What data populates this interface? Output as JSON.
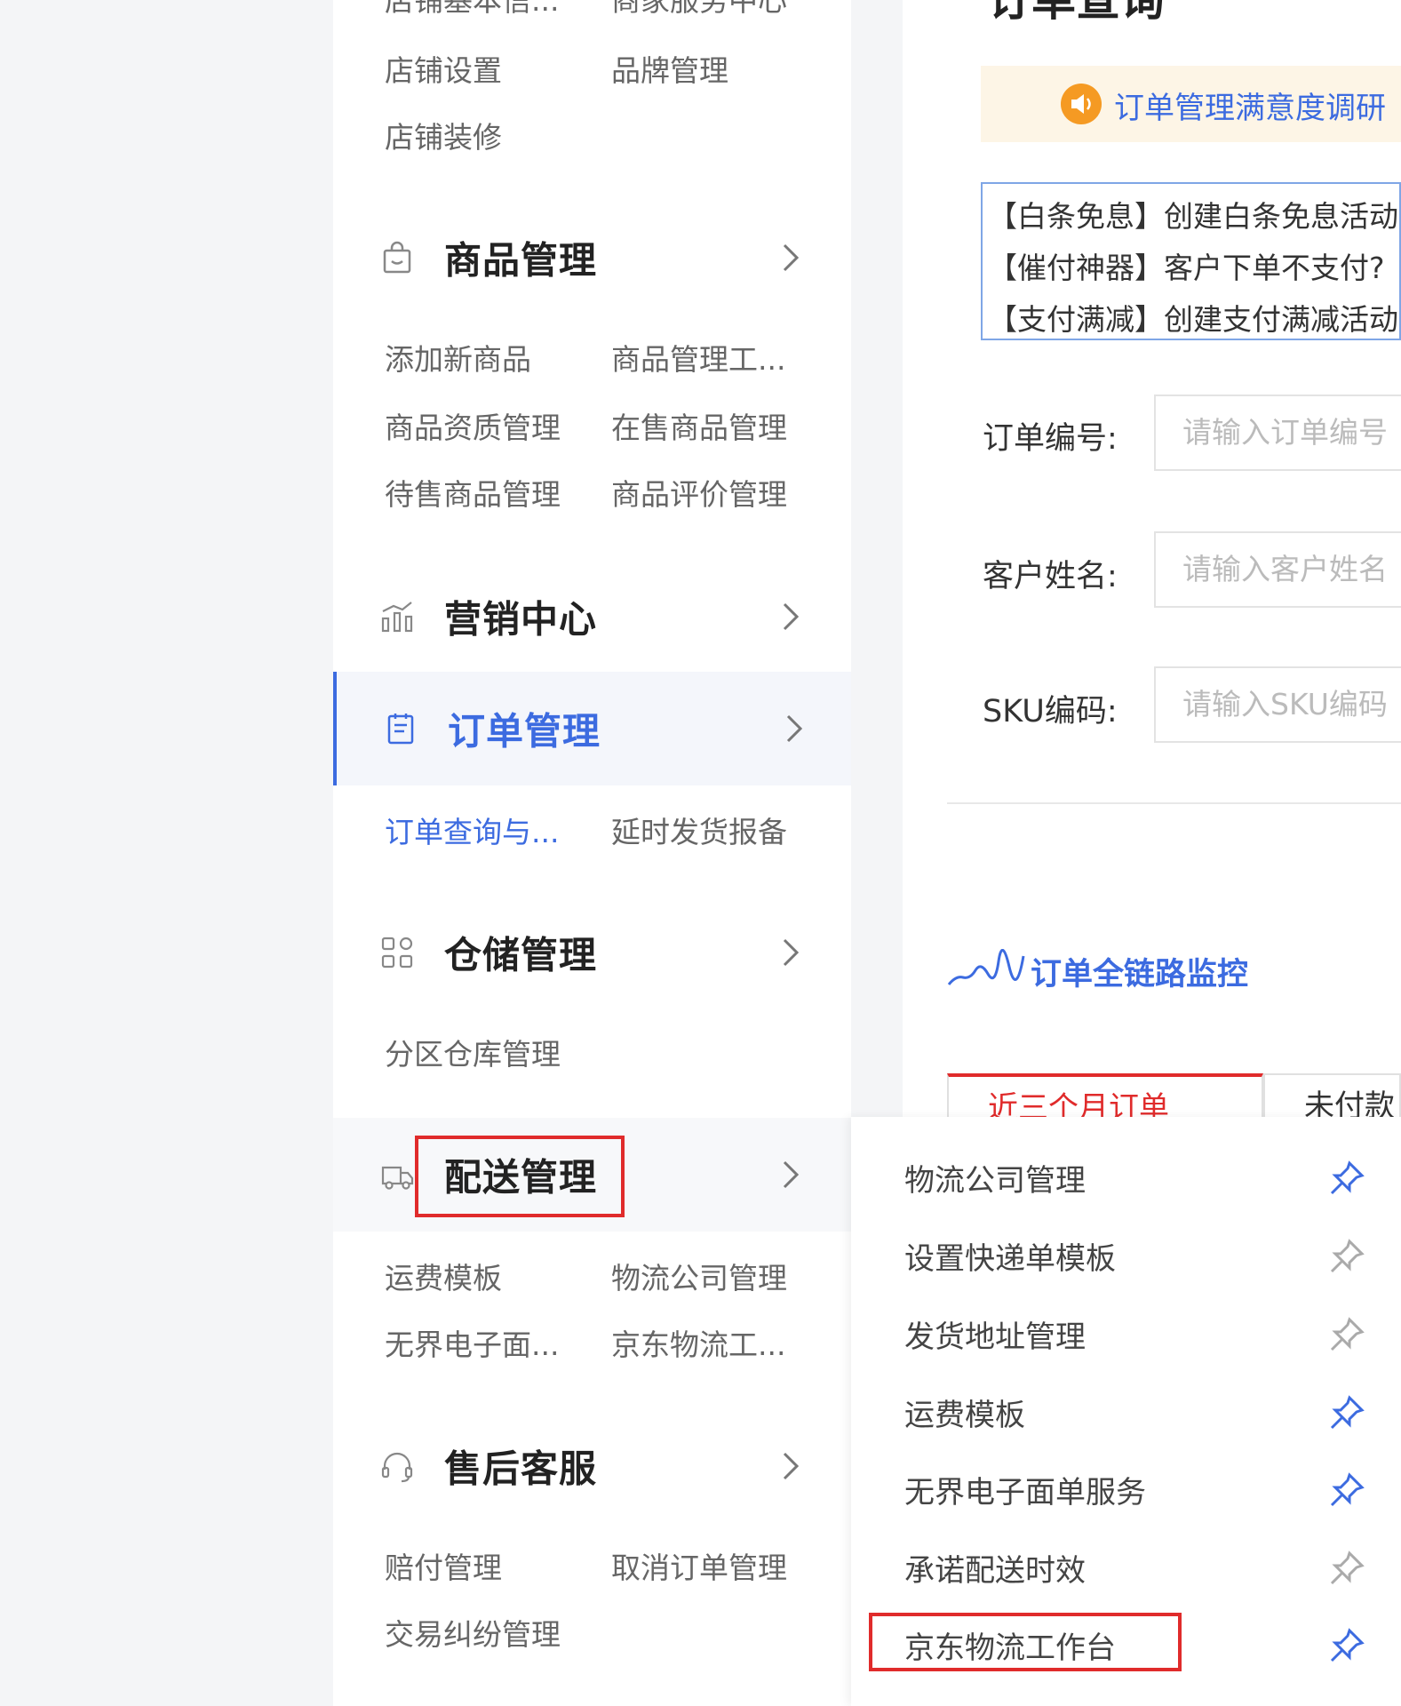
{
  "sidebar": {
    "shop": {
      "items": [
        "店铺基本信...",
        "商家服务中心",
        "店铺设置",
        "品牌管理",
        "店铺装修"
      ]
    },
    "sections": [
      {
        "title": "商品管理",
        "icon": "shopping-bag-icon",
        "items": [
          "添加新商品",
          "商品管理工...",
          "商品资质管理",
          "在售商品管理",
          "待售商品管理",
          "商品评价管理"
        ]
      },
      {
        "title": "营销中心",
        "icon": "bar-chart-icon",
        "items": []
      },
      {
        "title": "订单管理",
        "icon": "order-list-icon",
        "items": [
          "订单查询与...",
          "延时发货报备"
        ]
      },
      {
        "title": "仓储管理",
        "icon": "grid-apps-icon",
        "items": [
          "分区仓库管理"
        ]
      },
      {
        "title": "配送管理",
        "icon": "delivery-truck-icon",
        "items": [
          "运费模板",
          "物流公司管理",
          "无界电子面...",
          "京东物流工..."
        ]
      },
      {
        "title": "售后客服",
        "icon": "headset-icon",
        "items": [
          "赔付管理",
          "取消订单管理",
          "交易纠纷管理"
        ]
      }
    ]
  },
  "main": {
    "page_title": "订单查询",
    "notice": "订单管理满意度调研",
    "promos": [
      "【白条免息】创建白条免息活动",
      "【催付神器】客户下单不支付?",
      "【支付满减】创建支付满减活动"
    ],
    "form": [
      {
        "label": "订单编号:",
        "placeholder": "请输入订单编号"
      },
      {
        "label": "客户姓名:",
        "placeholder": "请输入客户姓名"
      },
      {
        "label": "SKU编码:",
        "placeholder": "请输入SKU编码"
      }
    ],
    "monitor_title": "订单全链路监控",
    "tabs": [
      "近三个月订单",
      "未付款"
    ]
  },
  "flyout": {
    "items": [
      {
        "label": "物流公司管理",
        "pinned": true
      },
      {
        "label": "设置快递单模板",
        "pinned": false
      },
      {
        "label": "发货地址管理",
        "pinned": false
      },
      {
        "label": "运费模板",
        "pinned": true
      },
      {
        "label": "无界电子面单服务",
        "pinned": true
      },
      {
        "label": "承诺配送时效",
        "pinned": false
      },
      {
        "label": "京东物流工作台",
        "pinned": true
      }
    ]
  },
  "colors": {
    "accent": "#3c6be0",
    "highlight": "#e02b2b",
    "notice_bg": "#fdf5e6"
  }
}
